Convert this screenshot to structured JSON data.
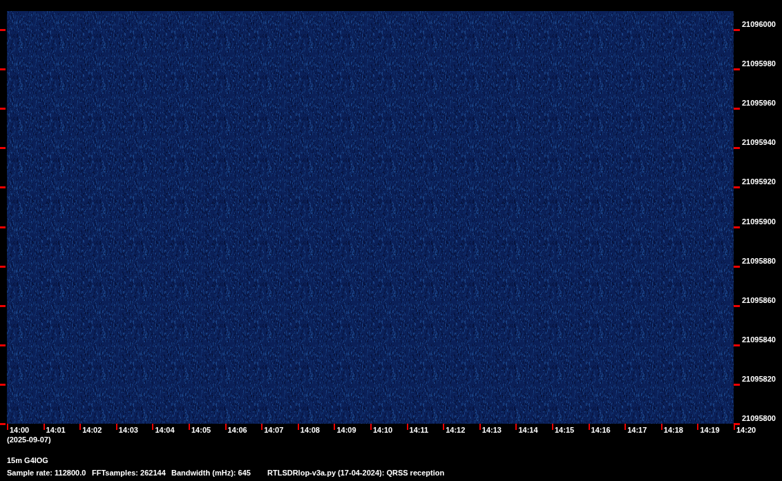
{
  "plot": {
    "frequency_labels": [
      "21096000",
      "21095980",
      "21095960",
      "21095940",
      "21095920",
      "21095900",
      "21095880",
      "21095860",
      "21095840",
      "21095820",
      "21095800"
    ],
    "time_labels": [
      "14:00",
      "14:01",
      "14:02",
      "14:03",
      "14:04",
      "14:05",
      "14:06",
      "14:07",
      "14:08",
      "14:09",
      "14:10",
      "14:11",
      "14:12",
      "14:13",
      "14:14",
      "14:15",
      "14:16",
      "14:17",
      "14:18",
      "14:19",
      "14:20"
    ],
    "date": "(2025-09-07)"
  },
  "info": {
    "station": "15m G4IOG",
    "fields": [
      "Sample rate: 112800.0",
      "FFTsamples: 262144",
      "Bandwidth (mHz): 645",
      "RTLSDRlop-v3a.py (17-04-2024): QRSS reception"
    ]
  }
}
